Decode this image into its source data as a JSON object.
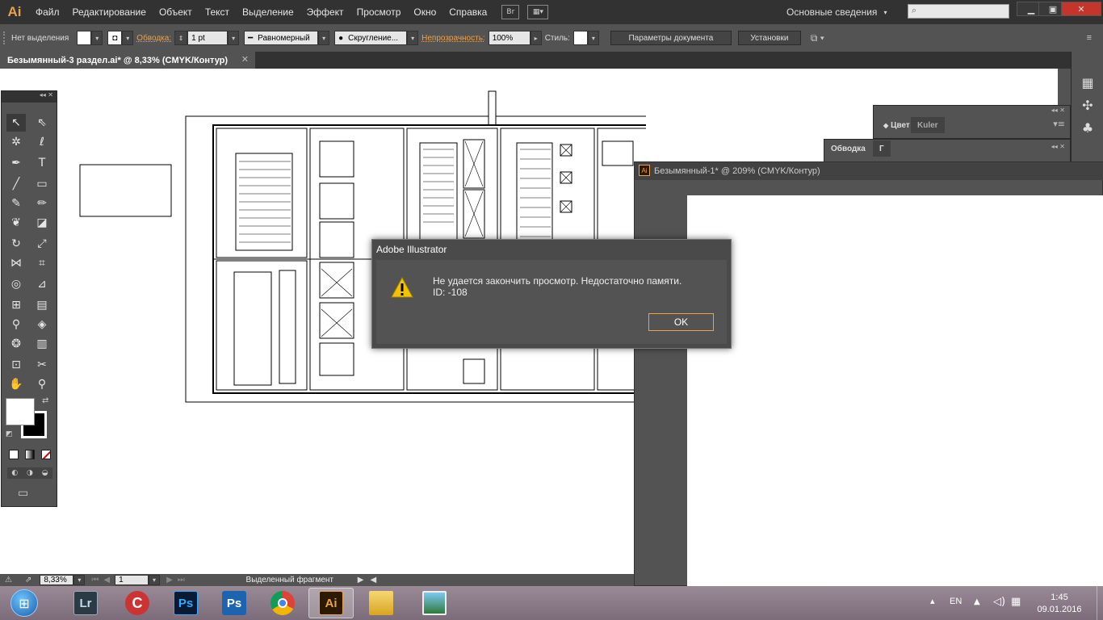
{
  "app": {
    "logo": "Ai",
    "menu": [
      "Файл",
      "Редактирование",
      "Объект",
      "Текст",
      "Выделение",
      "Эффект",
      "Просмотр",
      "Окно",
      "Справка"
    ],
    "bridge_label": "Br",
    "workspace": "Основные сведения",
    "search_placeholder": ""
  },
  "control_bar": {
    "selection_label": "Нет выделения",
    "stroke_label": "Обводка:",
    "stroke_value": "1 pt",
    "profile_value": "Равномерный",
    "brush_value": "Скругление...",
    "opacity_label": "Непрозрачность:",
    "opacity_value": "100%",
    "style_label": "Стиль:",
    "doc_settings_button": "Параметры документа",
    "preferences_button": "Установки"
  },
  "document": {
    "tab_title": "Безымянный-3 раздел.ai* @ 8,33% (CMYK/Контур)",
    "second_window_title": "Безымянный-1* @ 209% (CMYK/Контур)"
  },
  "panels": {
    "color_tab": "Цвет",
    "kuler_tab": "Kuler",
    "stroke_tab": "Обводка",
    "stroke_tab2": "Г"
  },
  "status_bar": {
    "zoom": "8,33%",
    "artboard": "1",
    "status_text": "Выделенный фрагмент"
  },
  "dialog": {
    "title": "Adobe Illustrator",
    "message": "Не удается закончить просмотр. Недостаточно памяти.",
    "error_id": "ID: -108",
    "ok_button": "OK"
  },
  "taskbar": {
    "apps": [
      "Lr",
      "Ps",
      "Ps",
      "Ai"
    ],
    "language": "EN",
    "time": "1:45",
    "date": "09.01.2016"
  },
  "colors": {
    "accent": "#e8a14f",
    "panel_bg": "#535353",
    "menubar_bg": "#323232"
  }
}
